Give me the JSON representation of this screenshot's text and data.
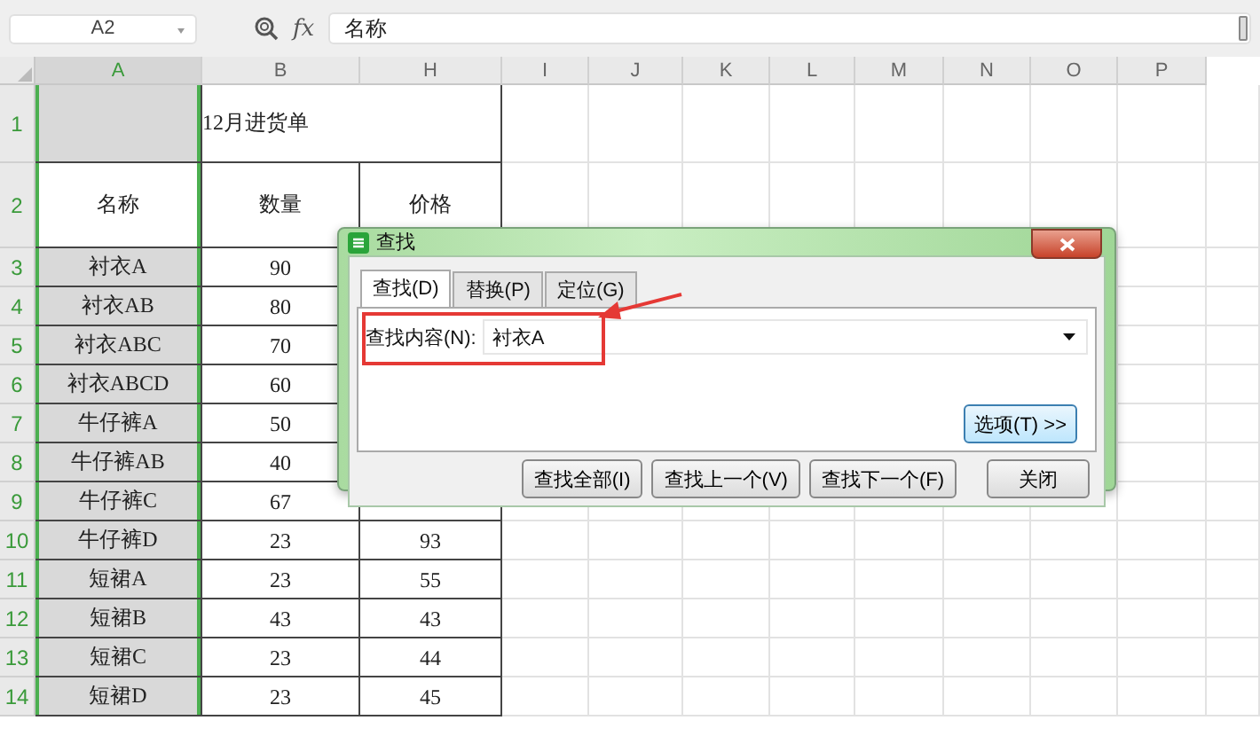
{
  "formula_bar": {
    "name_box": "A2",
    "formula": "名称",
    "function_label": "fx"
  },
  "sheet": {
    "columns": [
      {
        "label": "A",
        "selected": true
      },
      {
        "label": "B",
        "selected": false
      },
      {
        "label": "H",
        "selected": false
      },
      {
        "label": "I",
        "selected": false
      },
      {
        "label": "J",
        "selected": false
      },
      {
        "label": "K",
        "selected": false
      },
      {
        "label": "L",
        "selected": false
      },
      {
        "label": "M",
        "selected": false
      },
      {
        "label": "N",
        "selected": false
      },
      {
        "label": "O",
        "selected": false
      },
      {
        "label": "P",
        "selected": false
      }
    ],
    "rows": [
      {
        "number": "1",
        "active": false,
        "title": "12月进货单"
      },
      {
        "number": "2",
        "active": true,
        "cells": [
          "名称",
          "数量",
          "价格"
        ]
      },
      {
        "number": "3",
        "active": false,
        "cells": [
          "衬衣A",
          "90"
        ]
      },
      {
        "number": "4",
        "active": false,
        "cells": [
          "衬衣AB",
          "80"
        ]
      },
      {
        "number": "5",
        "active": false,
        "cells": [
          "衬衣ABC",
          "70"
        ]
      },
      {
        "number": "6",
        "active": false,
        "cells": [
          "衬衣ABCD",
          "60"
        ]
      },
      {
        "number": "7",
        "active": false,
        "cells": [
          "牛仔裤A",
          "50"
        ]
      },
      {
        "number": "8",
        "active": false,
        "cells": [
          "牛仔裤AB",
          "40"
        ]
      },
      {
        "number": "9",
        "active": false,
        "cells": [
          "牛仔裤C",
          "67"
        ]
      },
      {
        "number": "10",
        "active": false,
        "cells": [
          "牛仔裤D",
          "23",
          "93"
        ]
      },
      {
        "number": "11",
        "active": false,
        "cells": [
          "短裙A",
          "23",
          "55"
        ]
      },
      {
        "number": "12",
        "active": false,
        "cells": [
          "短裙B",
          "43",
          "43"
        ]
      },
      {
        "number": "13",
        "active": false,
        "cells": [
          "短裙C",
          "23",
          "44"
        ]
      },
      {
        "number": "14",
        "active": false,
        "cells": [
          "短裙D",
          "23",
          "45"
        ]
      }
    ]
  },
  "dialog": {
    "title": "查找",
    "tabs": [
      {
        "label": "查找(D)",
        "selected": true
      },
      {
        "label": "替换(P)",
        "selected": false
      },
      {
        "label": "定位(G)",
        "selected": false
      }
    ],
    "field": {
      "label": "查找内容(N):",
      "value": "衬衣A"
    },
    "options_button": {
      "label": "选项(T) >>",
      "default": true
    },
    "buttons": [
      "查找全部(I)",
      "查找上一个(V)",
      "查找下一个(F)",
      "关闭"
    ]
  }
}
